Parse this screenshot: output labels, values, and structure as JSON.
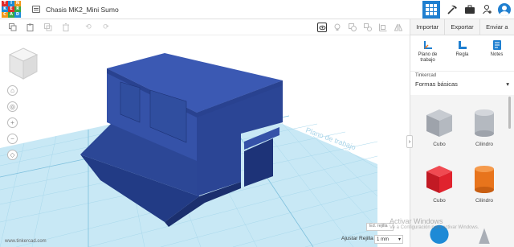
{
  "app": {
    "logo_letters": [
      "TIN",
      "KER",
      "CAD"
    ],
    "document_title": "Chasis MK2_Mini Sumo"
  },
  "top_icons": [
    "grid-view-icon",
    "hammer-pickaxe-icon",
    "briefcase-icon",
    "add-user-icon",
    "user-avatar-icon"
  ],
  "toolbar": {
    "tools": [
      "copy-icon",
      "paste-icon",
      "duplicate-icon",
      "delete-icon",
      "undo-icon",
      "redo-icon"
    ],
    "right_tools": [
      "view-icon",
      "lightbulb-icon",
      "group-icon",
      "ungroup-icon",
      "align-icon",
      "mirror-icon"
    ]
  },
  "panel": {
    "tabs": [
      "Importar",
      "Exportar",
      "Enviar a"
    ],
    "tools": [
      {
        "label": "Plano de trabajo",
        "icon": "workplane-icon"
      },
      {
        "label": "Regla",
        "icon": "ruler-icon"
      },
      {
        "label": "Notes",
        "icon": "notes-icon"
      }
    ],
    "library_source": "Tinkercad",
    "library_selected": "Formas básicas",
    "shapes": [
      {
        "label": "Cubo",
        "color": "#a9aeb6"
      },
      {
        "label": "Cilindro",
        "color": "#a9aeb6"
      },
      {
        "label": "Cubo",
        "color": "#e0232e"
      },
      {
        "label": "Cilindro",
        "color": "#e8741c"
      },
      {
        "label": "",
        "color": "#1e8ad6"
      },
      {
        "label": "",
        "color": "#a9aeb6"
      }
    ]
  },
  "viewport": {
    "workplane_label": "Plano de trabajo",
    "model_color": "#2d4a9a",
    "grid_color": "#a9d8ec",
    "url": "www.tinkercad.com",
    "edit_grid": "Ed. rejilla",
    "snap_grid_label": "Ajustar Rejilla",
    "snap_grid_value": "1 mm"
  },
  "overlay": {
    "activate_title": "Activar Windows",
    "activate_sub": "Ve a Configuración para activar Windows."
  }
}
